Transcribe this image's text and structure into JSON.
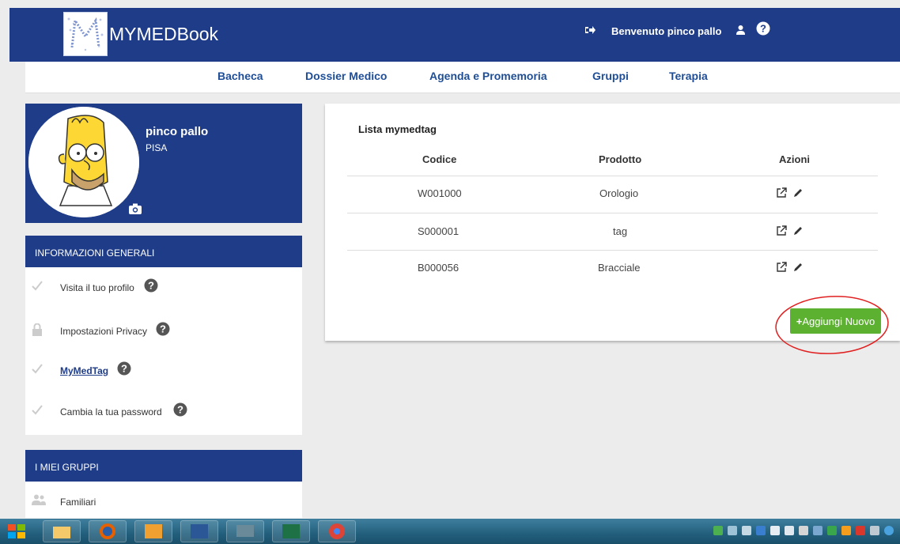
{
  "header": {
    "app_title": "MYMEDBook",
    "welcome_text": "Benvenuto pinco pallo",
    "brand_color": "#1f3c88"
  },
  "nav": {
    "items": [
      "Bacheca",
      "Dossier Medico",
      "Agenda e Promemoria",
      "Gruppi",
      "Terapia"
    ]
  },
  "profile": {
    "name": "pinco pallo",
    "city": "PISA"
  },
  "info_panel": {
    "title": "INFORMAZIONI GENERALI",
    "items": [
      {
        "label": "Visita il tuo profilo",
        "icon": "check-icon"
      },
      {
        "label": "Impostazioni Privacy",
        "icon": "lock-icon"
      },
      {
        "label": "MyMedTag",
        "icon": "check-icon"
      },
      {
        "label": "Cambia la tua password",
        "icon": "check-icon"
      }
    ]
  },
  "groups_panel": {
    "title": "I MIEI GRUPPI",
    "items": [
      {
        "label": "Familiari",
        "icon": "users-icon"
      }
    ]
  },
  "tag_list": {
    "title": "Lista mymedtag",
    "columns": [
      "Codice",
      "Prodotto",
      "Azioni"
    ],
    "rows": [
      {
        "codice": "W001000",
        "prodotto": "Orologio"
      },
      {
        "codice": "S000001",
        "prodotto": "tag"
      },
      {
        "codice": "B000056",
        "prodotto": "Bracciale"
      }
    ],
    "add_button": {
      "icon": "+",
      "label": "Aggiungi Nuovo"
    },
    "accent_color": "#5cb130",
    "highlight_color": "#e02020"
  }
}
